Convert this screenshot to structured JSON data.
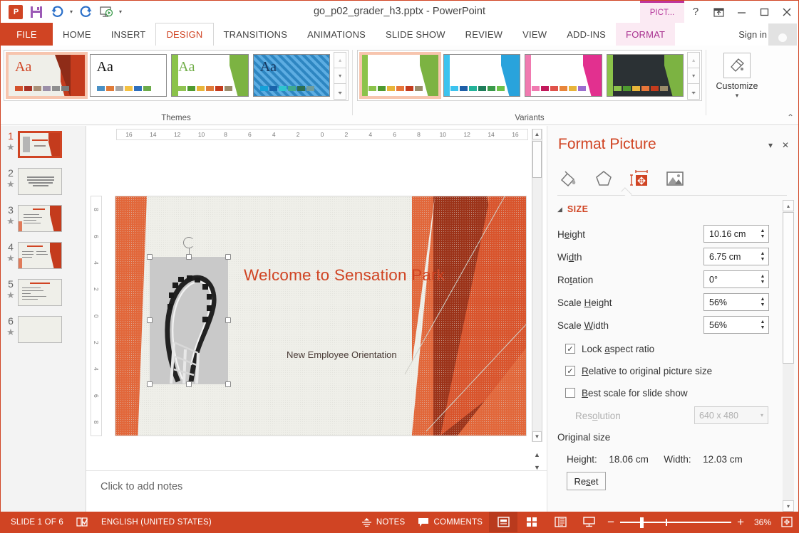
{
  "window": {
    "title": "go_p02_grader_h3.pptx - PowerPoint",
    "contextual_tab_top": "PICT...",
    "help_icon": "?",
    "ribbon_display_icon": "ribbon-display-options-icon",
    "minimize_icon": "—",
    "maximize_icon": "▢",
    "close_icon": "✕",
    "signin": "Sign in"
  },
  "qat": {
    "app_logo": "powerpoint-logo",
    "save": "save-icon",
    "undo": "undo-icon",
    "redo": "redo-icon",
    "slideshow": "start-slideshow-icon",
    "more": "customize-qat-icon"
  },
  "tabs": {
    "file": "FILE",
    "items": [
      {
        "label": "HOME",
        "active": false,
        "contextual": false
      },
      {
        "label": "INSERT",
        "active": false,
        "contextual": false
      },
      {
        "label": "DESIGN",
        "active": true,
        "contextual": false
      },
      {
        "label": "TRANSITIONS",
        "active": false,
        "contextual": false
      },
      {
        "label": "ANIMATIONS",
        "active": false,
        "contextual": false
      },
      {
        "label": "SLIDE SHOW",
        "active": false,
        "contextual": false
      },
      {
        "label": "REVIEW",
        "active": false,
        "contextual": false
      },
      {
        "label": "VIEW",
        "active": false,
        "contextual": false
      },
      {
        "label": "ADD-INS",
        "active": false,
        "contextual": false
      },
      {
        "label": "FORMAT",
        "active": false,
        "contextual": true
      }
    ]
  },
  "ribbon": {
    "themes_group_label": "Themes",
    "variants_group_label": "Variants",
    "customize_label": "Customize",
    "customize_caret": "▾",
    "collapse_icon": "⌃",
    "scroll_up": "▴",
    "scroll_down": "▾",
    "scroll_more": "▾",
    "themes": [
      {
        "name": "Facet-Berlin-orange",
        "aa": "Aa",
        "aa_color": "#d04423",
        "bg": "#efefe9",
        "accent": "#c43b1d",
        "swatches": [
          "#d4522c",
          "#a93226",
          "#a89078",
          "#9b8fa8",
          "#8f8f8f",
          "#7a7a7a"
        ],
        "selected": true
      },
      {
        "name": "Office-theme",
        "aa": "Aa",
        "aa_color": "#111111",
        "bg": "#ffffff",
        "accent": "#ffffff",
        "swatches": [
          "#4a90c4",
          "#e07b39",
          "#a6a6a6",
          "#f5c242",
          "#2f6fbd",
          "#6cab4a"
        ],
        "selected": false
      },
      {
        "name": "Facet-green",
        "aa": "Aa",
        "aa_color": "#70ad47",
        "bg": "#ffffff",
        "accent": "#78b23c",
        "swatches": [
          "#90c352",
          "#4e9a2f",
          "#e8b53a",
          "#e07b39",
          "#c43b1d",
          "#9b8b6a"
        ],
        "selected": false
      },
      {
        "name": "Damask-blue",
        "aa": "Aa",
        "aa_color": "#1f3864",
        "bg": "#2e86c1",
        "accent": "#2e86c1",
        "swatches": [
          "#15a0d8",
          "#1964ab",
          "#2fc4cf",
          "#3fa88f",
          "#2c6e52",
          "#6f9c9c"
        ],
        "selected": false
      }
    ],
    "variants": [
      {
        "name": "variant-green",
        "accent": "#7cb342",
        "swatches": [
          "#8bc34a",
          "#4e9a2f",
          "#e8b53a",
          "#e8763a",
          "#c43b1d",
          "#9b8b6a"
        ],
        "bg": "#ffffff",
        "selected": true
      },
      {
        "name": "variant-blue",
        "accent": "#29a3dc",
        "swatches": [
          "#3cc3ef",
          "#1e5fa8",
          "#23b39a",
          "#1e7d5a",
          "#3a9a4a",
          "#6cc24a"
        ],
        "bg": "#ffffff",
        "selected": false
      },
      {
        "name": "variant-pink",
        "accent": "#e2308f",
        "swatches": [
          "#f07ab0",
          "#c2185b",
          "#e0524a",
          "#e8853a",
          "#e8b53a",
          "#9b6fd0"
        ],
        "bg": "#ffffff",
        "selected": false
      },
      {
        "name": "variant-dark",
        "accent": "#7cb342",
        "swatches": [
          "#8bc34a",
          "#4e9a2f",
          "#e8b53a",
          "#e8763a",
          "#c43b1d",
          "#9b8b6a"
        ],
        "bg": "#2b3134",
        "selected": false
      }
    ]
  },
  "slides_pane": {
    "slides": [
      {
        "number": "1",
        "star": "★",
        "selected": true,
        "kind": "title"
      },
      {
        "number": "2",
        "star": "★",
        "selected": false,
        "kind": "quote"
      },
      {
        "number": "3",
        "star": "★",
        "selected": false,
        "kind": "bullets"
      },
      {
        "number": "4",
        "star": "★",
        "selected": false,
        "kind": "two-col"
      },
      {
        "number": "5",
        "star": "★",
        "selected": false,
        "kind": "list"
      },
      {
        "number": "6",
        "star": "★",
        "selected": false,
        "kind": "blank"
      }
    ]
  },
  "rulers": {
    "horizontal": [
      "16",
      "14",
      "12",
      "10",
      "8",
      "6",
      "4",
      "2",
      "0",
      "2",
      "4",
      "6",
      "8",
      "10",
      "12",
      "14",
      "16"
    ],
    "vertical": [
      "8",
      "6",
      "4",
      "2",
      "0",
      "2",
      "4",
      "6",
      "8"
    ]
  },
  "slide": {
    "title": "Welcome to Sensation Park",
    "subtitle": "New Employee Orientation",
    "title_color": "#d04423",
    "background_color": "#efefe9",
    "picture_name": "roller-coaster-photo",
    "selected": true
  },
  "notes": {
    "placeholder": "Click to add notes"
  },
  "format_picture": {
    "panel_title": "Format Picture",
    "dropdown_icon": "▾",
    "close_icon": "✕",
    "tabs": [
      {
        "name": "fill-and-line-icon",
        "active": false
      },
      {
        "name": "effects-icon",
        "active": false
      },
      {
        "name": "size-and-properties-icon",
        "active": true
      },
      {
        "name": "picture-icon",
        "active": false
      }
    ],
    "section": {
      "expander": "◢",
      "title": "SIZE"
    },
    "fields": [
      {
        "label": "H",
        "label_rest": "eight",
        "underline": "e",
        "value": "10.16 cm",
        "type": "spinner",
        "disabled": false
      },
      {
        "label": "Wi",
        "label_rest": "dth",
        "underline": "d",
        "value": "6.75 cm",
        "type": "spinner",
        "disabled": false
      },
      {
        "label": "Ro",
        "label_rest": "tation",
        "underline": "t",
        "value": "0°",
        "type": "spinner",
        "disabled": false
      },
      {
        "label": "Scale ",
        "label_rest": "eight",
        "underline": "H",
        "value": "56%",
        "type": "spinner",
        "disabled": false
      },
      {
        "label": "Scale ",
        "label_rest": "idth",
        "underline": "W",
        "value": "56%",
        "type": "spinner",
        "disabled": false
      }
    ],
    "checkboxes": [
      {
        "pre": "Lock ",
        "underline": "a",
        "post": "spect ratio",
        "checked": true,
        "check": "✓"
      },
      {
        "pre": "",
        "underline": "R",
        "post": "elative to original picture size",
        "checked": true,
        "check": "✓"
      },
      {
        "pre": "",
        "underline": "B",
        "post": "est scale for slide show",
        "checked": false,
        "check": ""
      }
    ],
    "resolution": {
      "label_pre": "Res",
      "label_underline": "o",
      "label_post": "lution",
      "value": "640 x 480",
      "caret": "▾",
      "disabled": true
    },
    "original_size": {
      "heading": "Original size",
      "height_label": "Height:",
      "height_value": "18.06 cm",
      "width_label": "Width:",
      "width_value": "12.03 cm"
    },
    "reset": {
      "pre": "Re",
      "underline": "s",
      "post": "et"
    },
    "scroll_up": "▴",
    "scroll_down": "▾"
  },
  "statusbar": {
    "slide_counter": "SLIDE 1 OF 6",
    "spellcheck_icon": "spellcheck-icon",
    "language": "ENGLISH (UNITED STATES)",
    "notes_icon": "notes-icon",
    "notes_label": "NOTES",
    "comments_icon": "comments-icon",
    "comments_label": "COMMENTS",
    "views": [
      {
        "name": "normal-view-button",
        "active": true
      },
      {
        "name": "slide-sorter-view-button",
        "active": false
      },
      {
        "name": "reading-view-button",
        "active": false
      },
      {
        "name": "slide-show-button",
        "active": false
      }
    ],
    "zoom_out": "−",
    "zoom_in": "+",
    "zoom_level": "36%",
    "fit_icon": "fit-slide-to-window-icon"
  },
  "colors": {
    "brand": "#d04423",
    "contextual": "#c0359c",
    "status_bar": "#d04423"
  }
}
